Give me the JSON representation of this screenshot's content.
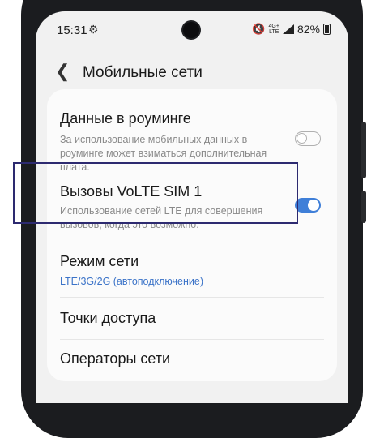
{
  "status_bar": {
    "time": "15:31",
    "network": "4G+\nLTE",
    "battery": "82%"
  },
  "header": {
    "title": "Мобильные сети"
  },
  "settings": [
    {
      "title": "Данные в роуминге",
      "subtitle": "За использование мобильных данных в роуминге может взиматься дополнительная плата.",
      "toggle": false
    },
    {
      "title": "Вызовы VoLTE SIM 1",
      "subtitle": "Использование сетей LTE для совершения вызовов, когда это возможно.",
      "toggle": true
    },
    {
      "title": "Режим сети",
      "value": "LTE/3G/2G (автоподключение)"
    },
    {
      "title": "Точки доступа"
    },
    {
      "title": "Операторы сети"
    }
  ],
  "colors": {
    "accent": "#3f7fd8",
    "highlight_border": "#2d2a70"
  },
  "icons": {
    "back": "chevron-left-icon",
    "gear": "gear-icon",
    "mute": "mute-icon"
  }
}
